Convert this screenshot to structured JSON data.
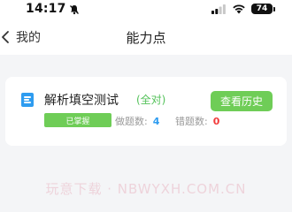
{
  "status_bar": {
    "time": "14:17",
    "battery": "74",
    "icons": [
      "bell-off-icon",
      "signal-icon",
      "wifi-icon",
      "battery-icon"
    ]
  },
  "nav": {
    "back_label": "我的",
    "title": "能力点"
  },
  "card": {
    "icon": "document-icon",
    "title": "解析填空测试",
    "result": "(全对)",
    "history_button": "查看历史",
    "badge": "已掌握",
    "done_label": "做题数:",
    "done_count": "4",
    "wrong_label": "错题数:",
    "wrong_count": "0"
  },
  "watermark": "玩意下载 · NBWYXH.COM.CN",
  "colors": {
    "accent_green": "#6fcd57",
    "accent_blue": "#2e9cf0",
    "error_red": "#f23b3b"
  }
}
